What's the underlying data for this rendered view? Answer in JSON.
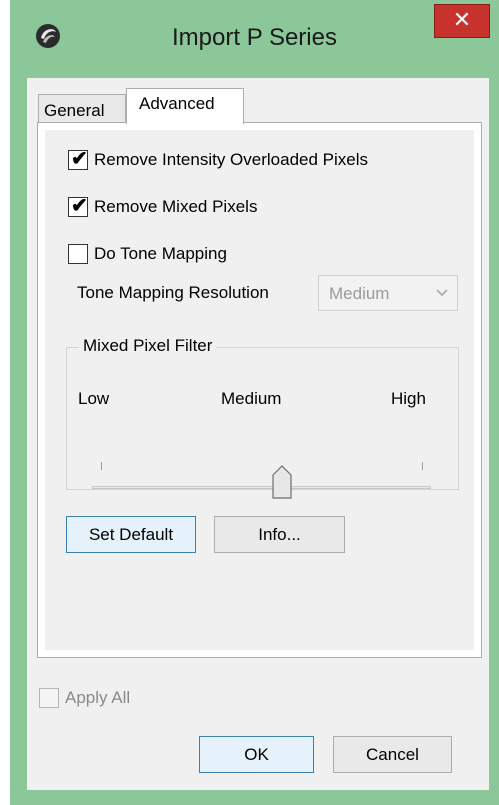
{
  "window": {
    "title": "Import P Series",
    "app_icon": "app-logo-icon",
    "close_glyph": "✕",
    "frame_color": "#8cc79a",
    "close_color": "#c7322c"
  },
  "tabs": [
    {
      "label": "General",
      "active": false
    },
    {
      "label": "Advanced",
      "active": true
    }
  ],
  "advanced": {
    "checkboxes": [
      {
        "label": "Remove Intensity Overloaded Pixels",
        "checked": true
      },
      {
        "label": "Remove Mixed Pixels",
        "checked": true
      },
      {
        "label": "Do Tone Mapping",
        "checked": false
      }
    ],
    "tone_mapping_resolution": {
      "label": "Tone Mapping Resolution",
      "value": "Medium",
      "enabled": false
    },
    "mixed_pixel_filter": {
      "title": "Mixed Pixel Filter",
      "low_label": "Low",
      "medium_label": "Medium",
      "high_label": "High",
      "level": 0.5
    },
    "buttons": {
      "set_default": "Set Default",
      "info": "Info..."
    }
  },
  "footer": {
    "apply_all": {
      "label": "Apply All",
      "checked": false,
      "enabled": false
    },
    "ok": "OK",
    "cancel": "Cancel"
  }
}
